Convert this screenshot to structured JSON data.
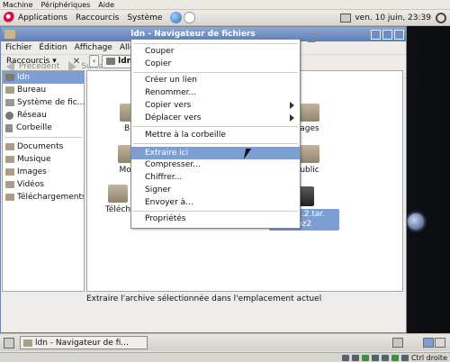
{
  "vm_menubar": {
    "items": [
      "Machine",
      "Périphériques",
      "Aide"
    ]
  },
  "top_panel": {
    "menus": [
      "Applications",
      "Raccourcis",
      "Système"
    ],
    "clock": "ven. 10 juin, 23:39"
  },
  "window": {
    "title": "ldn - Navigateur de fichiers",
    "menubar": [
      "Fichier",
      "Édition",
      "Affichage",
      "Alle"
    ],
    "toolbar": {
      "back": "Précédent",
      "forward": "Suivant"
    },
    "sidebar_combo": "Raccourcis",
    "path_button": "ldn",
    "sidebar": {
      "places": [
        "ldn",
        "Bureau",
        "Système de fic...",
        "Réseau",
        "Corbeille"
      ],
      "bookmarks": [
        "Documents",
        "Musique",
        "Images",
        "Vidéos",
        "Téléchargements"
      ]
    },
    "files": {
      "bureau": "Bu",
      "images": "ages",
      "modeles": "Mod",
      "public": "ublic",
      "telechargements": "Téléch",
      "archive": "l-0.7.2.tar.\nbz2"
    },
    "status": "Extraire l'archive sélectionnée dans l'emplacement actuel"
  },
  "context_menu": {
    "items": [
      "Couper",
      "Copier",
      "Créer un lien",
      "Renommer...",
      "Copier vers",
      "Déplacer vers",
      "Mettre à la corbeille",
      "Extraire ici",
      "Compresser...",
      "Chiffrer...",
      "Signer",
      "Envoyer à...",
      "Propriétés"
    ],
    "highlighted": "Extraire ici"
  },
  "taskbar": {
    "task": "ldn - Navigateur de fi..."
  },
  "vm_status": {
    "host_key": "Ctrl droite"
  }
}
